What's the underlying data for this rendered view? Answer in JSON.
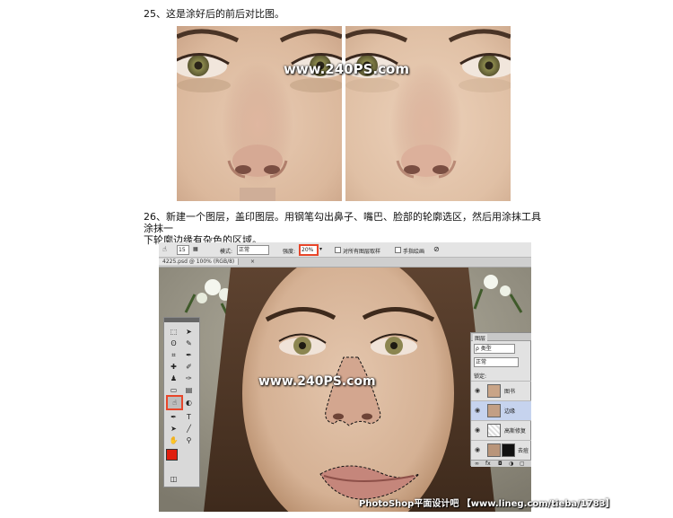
{
  "steps": {
    "step25": "25、这是涂好后的前后对比图。",
    "step26_line1": "26、新建一个图层，盖印图层。用钢笔勾出鼻子、嘴巴、脸部的轮廓选区，然后用涂抹工具涂抹一",
    "step26_line2": "下轮廓边缘有杂色的区域。"
  },
  "watermarks": {
    "comparison": "www.240PS.com",
    "screenshot": "www.240PS.com"
  },
  "photoshop": {
    "options_bar": {
      "brush_size": "15",
      "mode_label": "模式:",
      "mode_value": "正常",
      "strength_label": "强度:",
      "strength_value": "20%",
      "sample_all_layers": "对所有图层取样",
      "finger_painting": "手指绘画"
    },
    "document_tab": "4225.psd @ 100% (RGB/8)",
    "layers_panel": {
      "tab_label": "图层",
      "filter_label": "ρ 类型",
      "blend_mode": "正常",
      "lock_label": "锁定:",
      "layers": [
        {
          "name": "图书"
        },
        {
          "name": "边缘"
        },
        {
          "name": "高斯修复"
        },
        {
          "name": "去痘"
        }
      ]
    },
    "colors": {
      "foreground": "#e01f0f",
      "background": "#000000",
      "highlight_box": "#e8462a"
    }
  },
  "footer_credit": "PhotoShop平面设计吧 【www.lineg.com/tieba/1783】"
}
